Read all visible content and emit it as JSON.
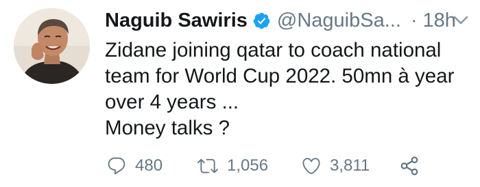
{
  "tweet": {
    "author_name": "Naguib Sawiris",
    "handle": "@NaguibSa...",
    "dot": "·",
    "time": "18h",
    "text_lines": [
      "Zidane joining qatar to coach national",
      "team for World Cup 2022. 50mn à year",
      "over 4 years ...",
      "Money talks ?"
    ],
    "replies": "480",
    "retweets": "1,056",
    "likes": "3,811"
  },
  "icons": {
    "verified": "verified-badge-icon",
    "caret": "chevron-down-icon",
    "reply": "reply-icon",
    "retweet": "retweet-icon",
    "like": "heart-icon",
    "share": "share-icon"
  },
  "colors": {
    "text": "#14171a",
    "secondary": "#657786",
    "verified": "#1da1f2"
  }
}
